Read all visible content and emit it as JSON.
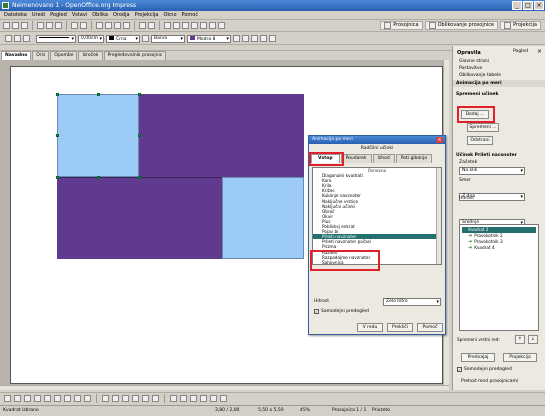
{
  "window": {
    "title": "Neimenovano 1 - OpenOffice.org Impress",
    "minimize": "_",
    "maximize": "□",
    "close": "×"
  },
  "menu": [
    "Datoteka",
    "Uredi",
    "Pogled",
    "Vstavi",
    "Oblika",
    "Orodja",
    "Projekcija",
    "Okno",
    "Pomoč"
  ],
  "toolbar": {
    "rocnica": "Prosojnica",
    "oblikovanje": "Oblikovanje prosojnice",
    "projekcija": "Projekcija"
  },
  "format_bar": {
    "line_width": "0,00cm",
    "line_color": "Črna",
    "area_type": "Barva",
    "area_color": "Modra 8"
  },
  "tabs": [
    "Navadno",
    "Oris",
    "Opombe",
    "Izroček",
    "Pregledovalnik prosojnic"
  ],
  "task_panel": {
    "title": "Opravila",
    "view_label": "Pogled",
    "close": "×",
    "sections": [
      "Glavne strani",
      "Postavitve",
      "Oblikovanje tabele"
    ],
    "active_section": "Animacija po meri",
    "modify_label": "Spremeni učinek",
    "add_button": "Dodaj ...",
    "change_button": "Spremeni ...",
    "remove_button": "Odstrani",
    "effect_label": "Učinek Prileti nacsnoter",
    "start_label": "Začetek",
    "start_value": "Na klik",
    "direction_label": "Smer",
    "direction_value": "Z dna",
    "speed_label": "Hitrost",
    "speed_value": "Srednje",
    "tree": [
      "Kvadrat 2",
      "Pravokotnik 2",
      "Pravokotnik 3",
      "Kvadrat 4"
    ],
    "order_label": "Spremeni vrstni red:",
    "play_button": "Predvajaj",
    "slideshow_button": "Projekcija",
    "autopreview_label": "Samodejni predogled",
    "next_label": "Prehod med prosojnicami"
  },
  "dialog": {
    "title": "Animacija po meri",
    "subtitle": "Radčilni učinki",
    "tabs": [
      "Vstop",
      "Poudarek",
      "Izhod",
      "Poti gibanja"
    ],
    "list": [
      "Osnovno",
      "Diagonalni kvadrati",
      "Karo",
      "Krila",
      "Križec",
      "Kukanje navznoter",
      "Naključne vrstice",
      "Naključni učinki",
      "Obroč",
      "Okvir",
      "Plus",
      "Poblisksj enkrat",
      "Pojav bi",
      "Prileti navznoter",
      "Prileti navznoter počasi",
      "Prizma",
      "Razdeli",
      "Razpadajme navznoter",
      "Šahovnica"
    ],
    "selected_index": 13,
    "speed_label": "Hitrost",
    "speed_value": "Zelo hitro",
    "autopreview_label": "Samodejni predogled",
    "ok": "V redu",
    "cancel": "Prekliči",
    "help": "Pomoč"
  },
  "status": {
    "shape": "Kvadrat izbrano",
    "position": "3,80 / 2,00",
    "size": "5,50 x 5,50",
    "slide": "Prosojnica 1 / 1",
    "layout": "Privzeto",
    "zoom": "45%"
  },
  "colors": {
    "purple": "#5f3a8e",
    "blue": "#9ccbf6",
    "selection": "#24706f",
    "highlight": "#e0202a"
  }
}
